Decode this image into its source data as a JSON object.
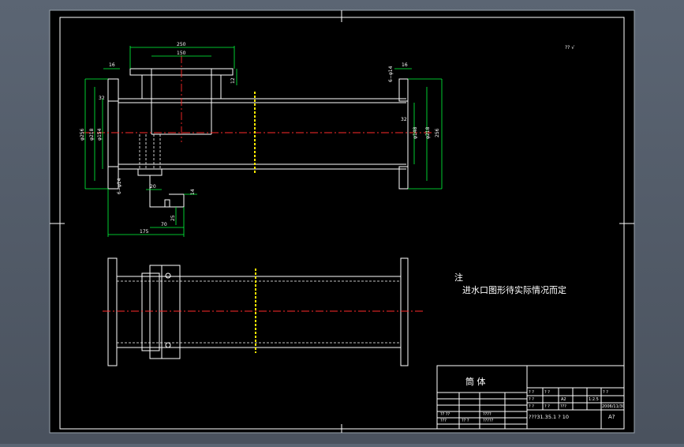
{
  "drawing": {
    "corner_mark": "?? √",
    "dimensions": {
      "d250": "250",
      "d150": "150",
      "d16_left": "16",
      "d16_right": "16",
      "d12": "12",
      "d6phi14_right": "6−φ14",
      "d32_left": "32",
      "d32_right": "32",
      "d6phi14_left": "6−φ14",
      "phi256": "φ256",
      "phi218_left": "φ218",
      "phi154": "φ154",
      "phi148": "φ148",
      "phi218_right": "φ218",
      "d256_right": "256",
      "d20": "20",
      "d14": "14",
      "d25": "25",
      "d70": "70",
      "d175": "175"
    },
    "notes": {
      "heading": "注",
      "line1": "进水口图形待实际情况而定"
    },
    "title_block": {
      "part_name": "筒   体",
      "drawing_number": "???31.35.1 ? 10",
      "sheet_size": "A?",
      "date": "2006/11/30",
      "scale": "1:2.5",
      "material": "A2",
      "cells": [
        "? ?",
        "? ?",
        "? ?",
        "? ?",
        "? ?",
        "? ?",
        "???",
        "????",
        "?????",
        "?? ??",
        "???",
        "?? ?"
      ]
    }
  }
}
